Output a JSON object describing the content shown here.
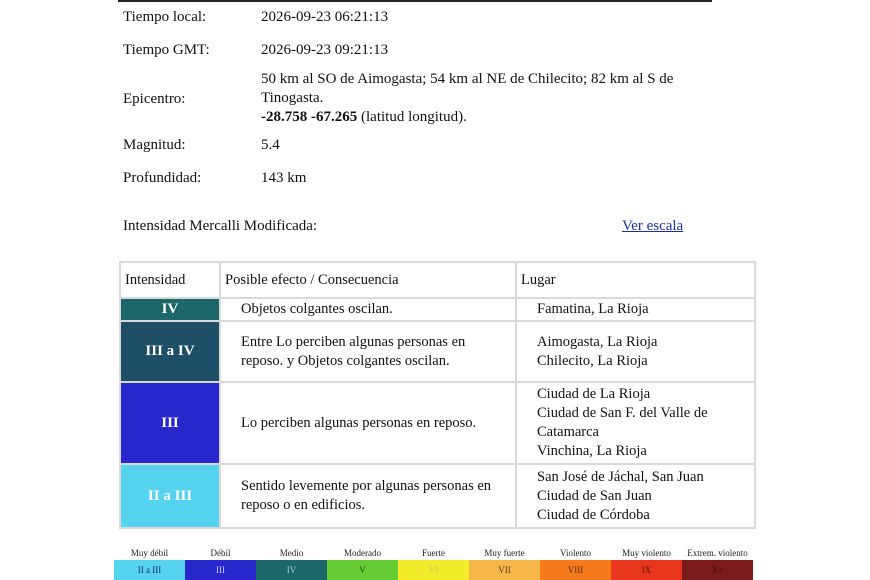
{
  "info": [
    {
      "label": "Tiempo local:",
      "value": "2026-09-23 06:21:13"
    },
    {
      "label": "Tiempo GMT:",
      "value": "2026-09-23 09:21:13"
    },
    {
      "label": "Epicentro:",
      "value": "50 km al SO de Aimogasta; 54 km al NE de Chilecito; 82 km al S de Tinogasta.",
      "lat": "-28.758",
      "lon": "-67.265",
      "coord_suffix": " (latitud longitud)."
    },
    {
      "label": "Magnitud:",
      "value": "5.4"
    },
    {
      "label": "Profundidad:",
      "value": "143 km"
    }
  ],
  "intensity_title": "Intensidad Mercalli Modificada:",
  "scale_link": "Ver escala",
  "table": {
    "headers": [
      "Intensidad",
      "Posible efecto / Consecuencia",
      "Lugar"
    ],
    "rows": [
      {
        "level": "IV",
        "color": "#1b6769",
        "effect": "Objetos colgantes oscilan.",
        "places": [
          "Famatina, La Rioja"
        ]
      },
      {
        "level": "III a IV",
        "color": "#1f4f66",
        "effect": "Entre Lo perciben algunas personas en reposo. y Objetos colgantes oscilan.",
        "places": [
          "Aimogasta, La Rioja",
          "Chilecito, La Rioja"
        ]
      },
      {
        "level": "III",
        "color": "#2727cc",
        "effect": "Lo perciben algunas personas en reposo.",
        "places": [
          "Ciudad de La Rioja",
          "Ciudad de San F. del Valle de Catamarca",
          "Vinchina, La Rioja"
        ]
      },
      {
        "level": "II a III",
        "color": "#55d3ef",
        "effect": "Sentido levemente por algunas personas en reposo o en edificios.",
        "places": [
          "San José de Jáchal, San Juan",
          "Ciudad de San Juan",
          "Ciudad de Córdoba"
        ]
      }
    ]
  },
  "legend": [
    {
      "name": "Muy débil",
      "code": "II a III",
      "color": "#55d3ef",
      "text_color": "#1a2a66"
    },
    {
      "name": "Débil",
      "code": "III",
      "color": "#2727cc",
      "text_color": "#c9c9ff"
    },
    {
      "name": "Medio",
      "code": "IV",
      "color": "#1b6769",
      "text_color": "#9fd0d0"
    },
    {
      "name": "Moderado",
      "code": "V",
      "color": "#66cc33",
      "text_color": "#1f4f10"
    },
    {
      "name": "Fuerte",
      "code": "VI",
      "color": "#f2ec2a",
      "text_color": "#c9c270"
    },
    {
      "name": "Muy fuerte",
      "code": "VII",
      "color": "#f6b64a",
      "text_color": "#5a3a10"
    },
    {
      "name": "Violento",
      "code": "VIII",
      "color": "#f57a1c",
      "text_color": "#5a2a08"
    },
    {
      "name": "Muy violento",
      "code": "IX",
      "color": "#e8361c",
      "text_color": "#5a1208"
    },
    {
      "name": "Extrem. violento",
      "code": "X+",
      "color": "#7a1a1a",
      "text_color": "#4a0a0a"
    }
  ]
}
